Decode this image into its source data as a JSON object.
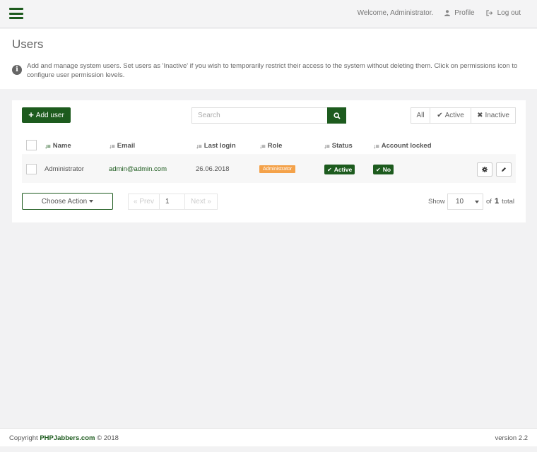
{
  "topbar": {
    "welcome": "Welcome, Administrator.",
    "profile_label": "Profile",
    "logout_label": "Log out"
  },
  "header": {
    "title": "Users",
    "info": "Add and manage system users. Set users as 'Inactive' if you wish to temporarily restrict their access to the system without deleting them. Click on permissions icon to configure user permission levels."
  },
  "toolbar": {
    "add_label": "Add user",
    "search_placeholder": "Search",
    "filters": [
      "All",
      "Active",
      "Inactive"
    ]
  },
  "table": {
    "columns": [
      "Name",
      "Email",
      "Last login",
      "Role",
      "Status",
      "Account locked"
    ],
    "rows": [
      {
        "name": "Administrator",
        "email": "admin@admin.com",
        "last_login": "26.06.2018",
        "role": "Administrator",
        "status": "Active",
        "locked": "No"
      }
    ]
  },
  "bottom": {
    "choose_action": "Choose Action",
    "prev": "« Prev",
    "page": "1",
    "next": "Next »",
    "show_label": "Show",
    "per_page": "10",
    "of_label": "of",
    "total_pages": "1",
    "total_label": "total"
  },
  "footer": {
    "copyright_prefix": "Copyright",
    "brand": "PHPJabbers.com",
    "copyright_suffix": "© 2018",
    "version": "version 2.2"
  },
  "colors": {
    "accent": "#1d5b1e",
    "role_badge": "#f4a24a"
  }
}
